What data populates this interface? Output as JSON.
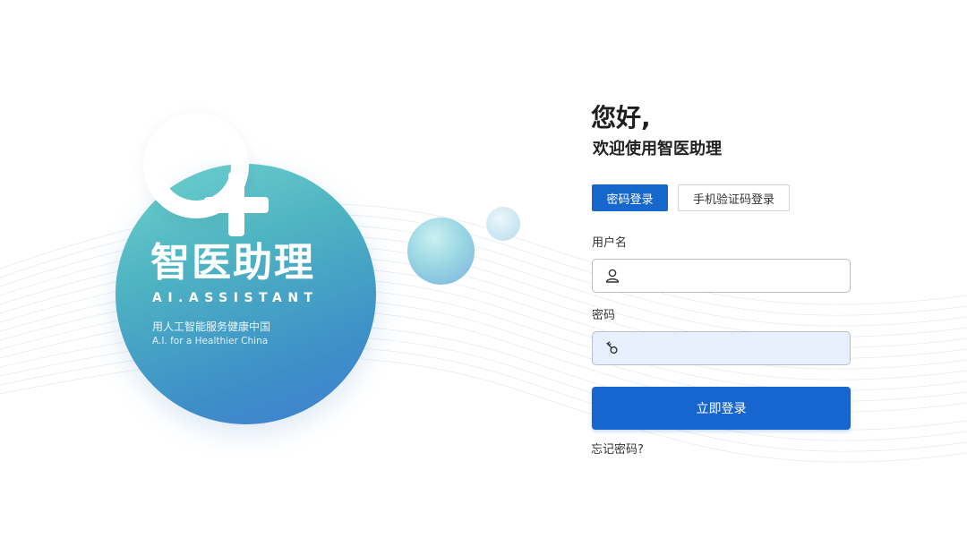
{
  "brand": {
    "title": "智医助理",
    "title_en": "AI.ASSISTANT",
    "slogan_cn": "用人工智能服务健康中国",
    "slogan_en": "A.I. for a Healthier China"
  },
  "login": {
    "greeting": "您好,",
    "welcome": "欢迎使用智医助理",
    "tabs": [
      {
        "label": "密码登录",
        "active": true
      },
      {
        "label": "手机验证码登录",
        "active": false
      }
    ],
    "username_label": "用户名",
    "username_value": "",
    "password_label": "密码",
    "password_value": "",
    "submit_label": "立即登录",
    "forgot_label": "忘记密码?"
  },
  "icons": {
    "username": "user-icon",
    "password": "key-icon"
  },
  "colors": {
    "primary": "#1766cf",
    "password_field_bg": "#e9f0fd"
  }
}
